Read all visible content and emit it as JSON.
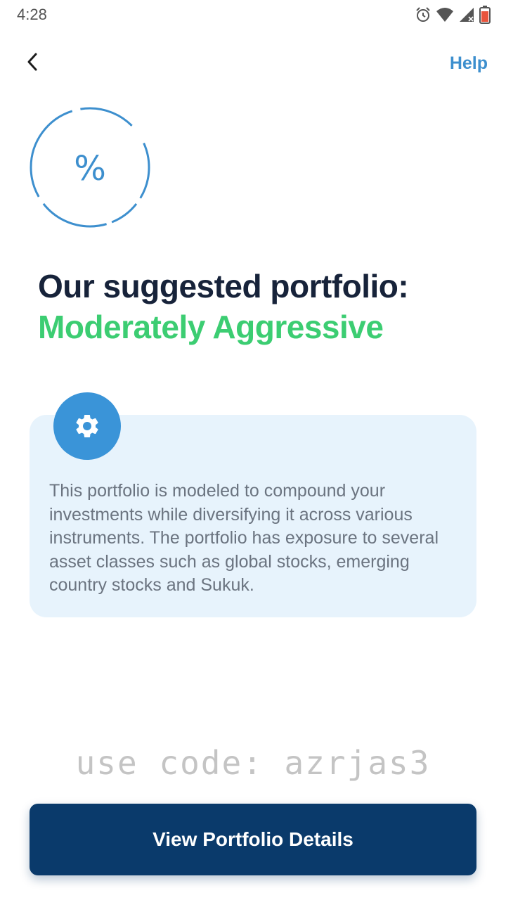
{
  "status_bar": {
    "time": "4:28",
    "icons": [
      "alarm-icon",
      "wifi-icon",
      "signal-icon",
      "battery-icon"
    ]
  },
  "nav": {
    "back_icon": "chevron-left-icon",
    "help_label": "Help"
  },
  "hero": {
    "icon": "percent-icon",
    "symbol": "%"
  },
  "heading": {
    "line1": "Our suggested portfolio:",
    "line2": "Moderately Aggressive"
  },
  "card": {
    "icon": "gear-icon",
    "description": "This portfolio is modeled to compound your investments while diversifying it across various instruments. The portfolio has exposure to several asset classes such as global stocks, emerging country stocks and Sukuk."
  },
  "promo": {
    "text": "use code: azrjas3"
  },
  "cta": {
    "label": "View Portfolio Details"
  },
  "colors": {
    "accent_blue": "#3d8fce",
    "heading_dark": "#17233a",
    "risk_green": "#3ccd72",
    "card_bg": "#e7f3fc",
    "button_bg": "#0a3a6b"
  }
}
